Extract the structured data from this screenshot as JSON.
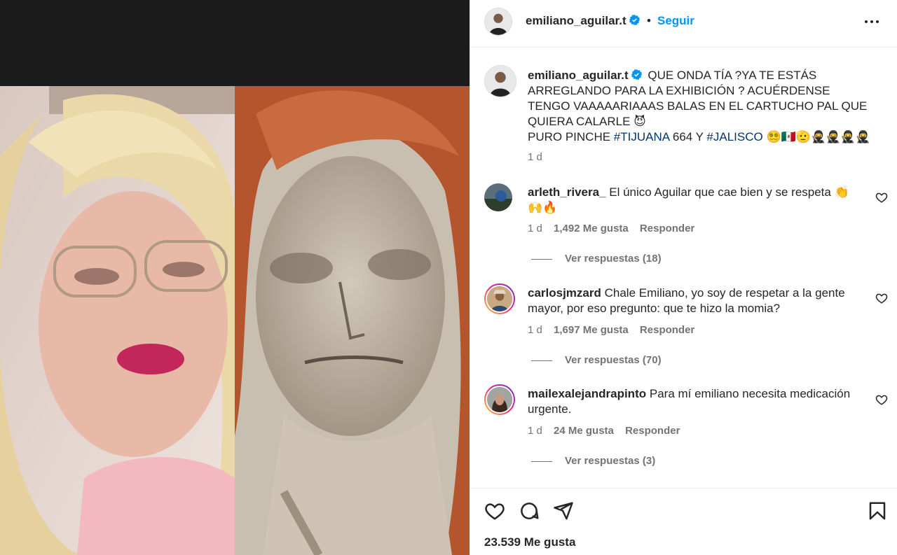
{
  "post": {
    "username": "emiliano_aguilar.t",
    "follow_label": "Seguir",
    "separator": "•",
    "likes": "23.539 Me gusta"
  },
  "caption": {
    "username": "emiliano_aguilar.t",
    "text_1": "QUE ONDA TÍA ?YA TE ESTÁS ARREGLANDO PARA LA EXHIBICIÓN ? ACUÉRDENSE TENGO VAAAAARIAAAS BALAS EN EL CARTUCHO PAL QUE QUIERA CALARLE 😈",
    "text_2a": "PURO PINCHE ",
    "hashtag_1": "#TIJUANA",
    "text_2b": " 664 Y ",
    "hashtag_2": "#JALISCO",
    "text_2c": " 😵‍💫🇲🇽🫡🥷🥷🥷🥷",
    "time": "1 d"
  },
  "comments": [
    {
      "username": "arleth_rivera_",
      "text": "El único Aguilar que cae bien y se respeta 👏🙌🔥",
      "time": "1 d",
      "likes": "1,492 Me gusta",
      "reply": "Responder",
      "replies": "Ver respuestas (18)"
    },
    {
      "username": "carlosjmzard",
      "text": "Chale Emiliano, yo soy de respetar a la gente mayor, por eso pregunto: que te hizo la momia?",
      "time": "1 d",
      "likes": "1,697 Me gusta",
      "reply": "Responder",
      "replies": "Ver respuestas (70)"
    },
    {
      "username": "mailexalejandrapinto",
      "text": "Para mí emiliano necesita medicación urgente.",
      "time": "1 d",
      "likes": "24 Me gusta",
      "reply": "Responder",
      "replies": "Ver respuestas (3)"
    }
  ],
  "icons": {
    "verified": "verified-badge-icon",
    "more": "more-options-icon",
    "like": "heart-icon",
    "comment": "comment-icon",
    "share": "share-icon",
    "save": "bookmark-icon"
  },
  "colors": {
    "accent": "#0095f6",
    "hashtag": "#00376b",
    "muted": "#737373"
  }
}
